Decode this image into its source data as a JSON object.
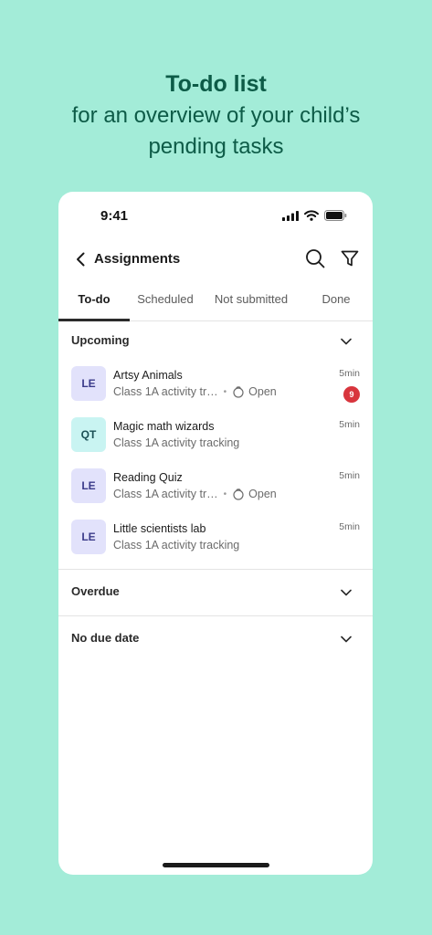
{
  "headline": {
    "title": "To-do list",
    "subtitle_line1": "for an overview of your child’s",
    "subtitle_line2": "pending tasks"
  },
  "status_bar": {
    "time": "9:41",
    "icons": [
      "signal-icon",
      "wifi-icon",
      "battery-icon"
    ]
  },
  "header": {
    "title": "Assignments",
    "icons": [
      "back-icon",
      "search-icon",
      "filter-icon"
    ]
  },
  "tabs": [
    {
      "label": "To-do",
      "active": true
    },
    {
      "label": "Scheduled",
      "active": false
    },
    {
      "label": "Not submitted",
      "active": false
    },
    {
      "label": "Done",
      "active": false
    }
  ],
  "sections": {
    "upcoming": {
      "title": "Upcoming",
      "items": [
        {
          "avatar": "LE",
          "title": "Artsy Animals",
          "subtitle": "Class 1A activity tr…",
          "status": "Open",
          "time": "5min",
          "badge": "9"
        },
        {
          "avatar": "QT",
          "title": "Magic math wizards",
          "subtitle": "Class 1A activity tracking",
          "time": "5min"
        },
        {
          "avatar": "LE",
          "title": "Reading Quiz",
          "subtitle": "Class 1A activity tr…",
          "status": "Open",
          "time": "5min"
        },
        {
          "avatar": "LE",
          "title": "Little scientists lab",
          "subtitle": "Class 1A activity tracking",
          "time": "5min"
        }
      ]
    },
    "overdue": {
      "title": "Overdue"
    },
    "no_due_date": {
      "title": "No due date"
    }
  },
  "colors": {
    "background": "#a3ecd8",
    "headline": "#0d5b47",
    "badge": "#d8353d",
    "avatar_le": "#e2e2fb",
    "avatar_qt": "#c9f4f2"
  }
}
